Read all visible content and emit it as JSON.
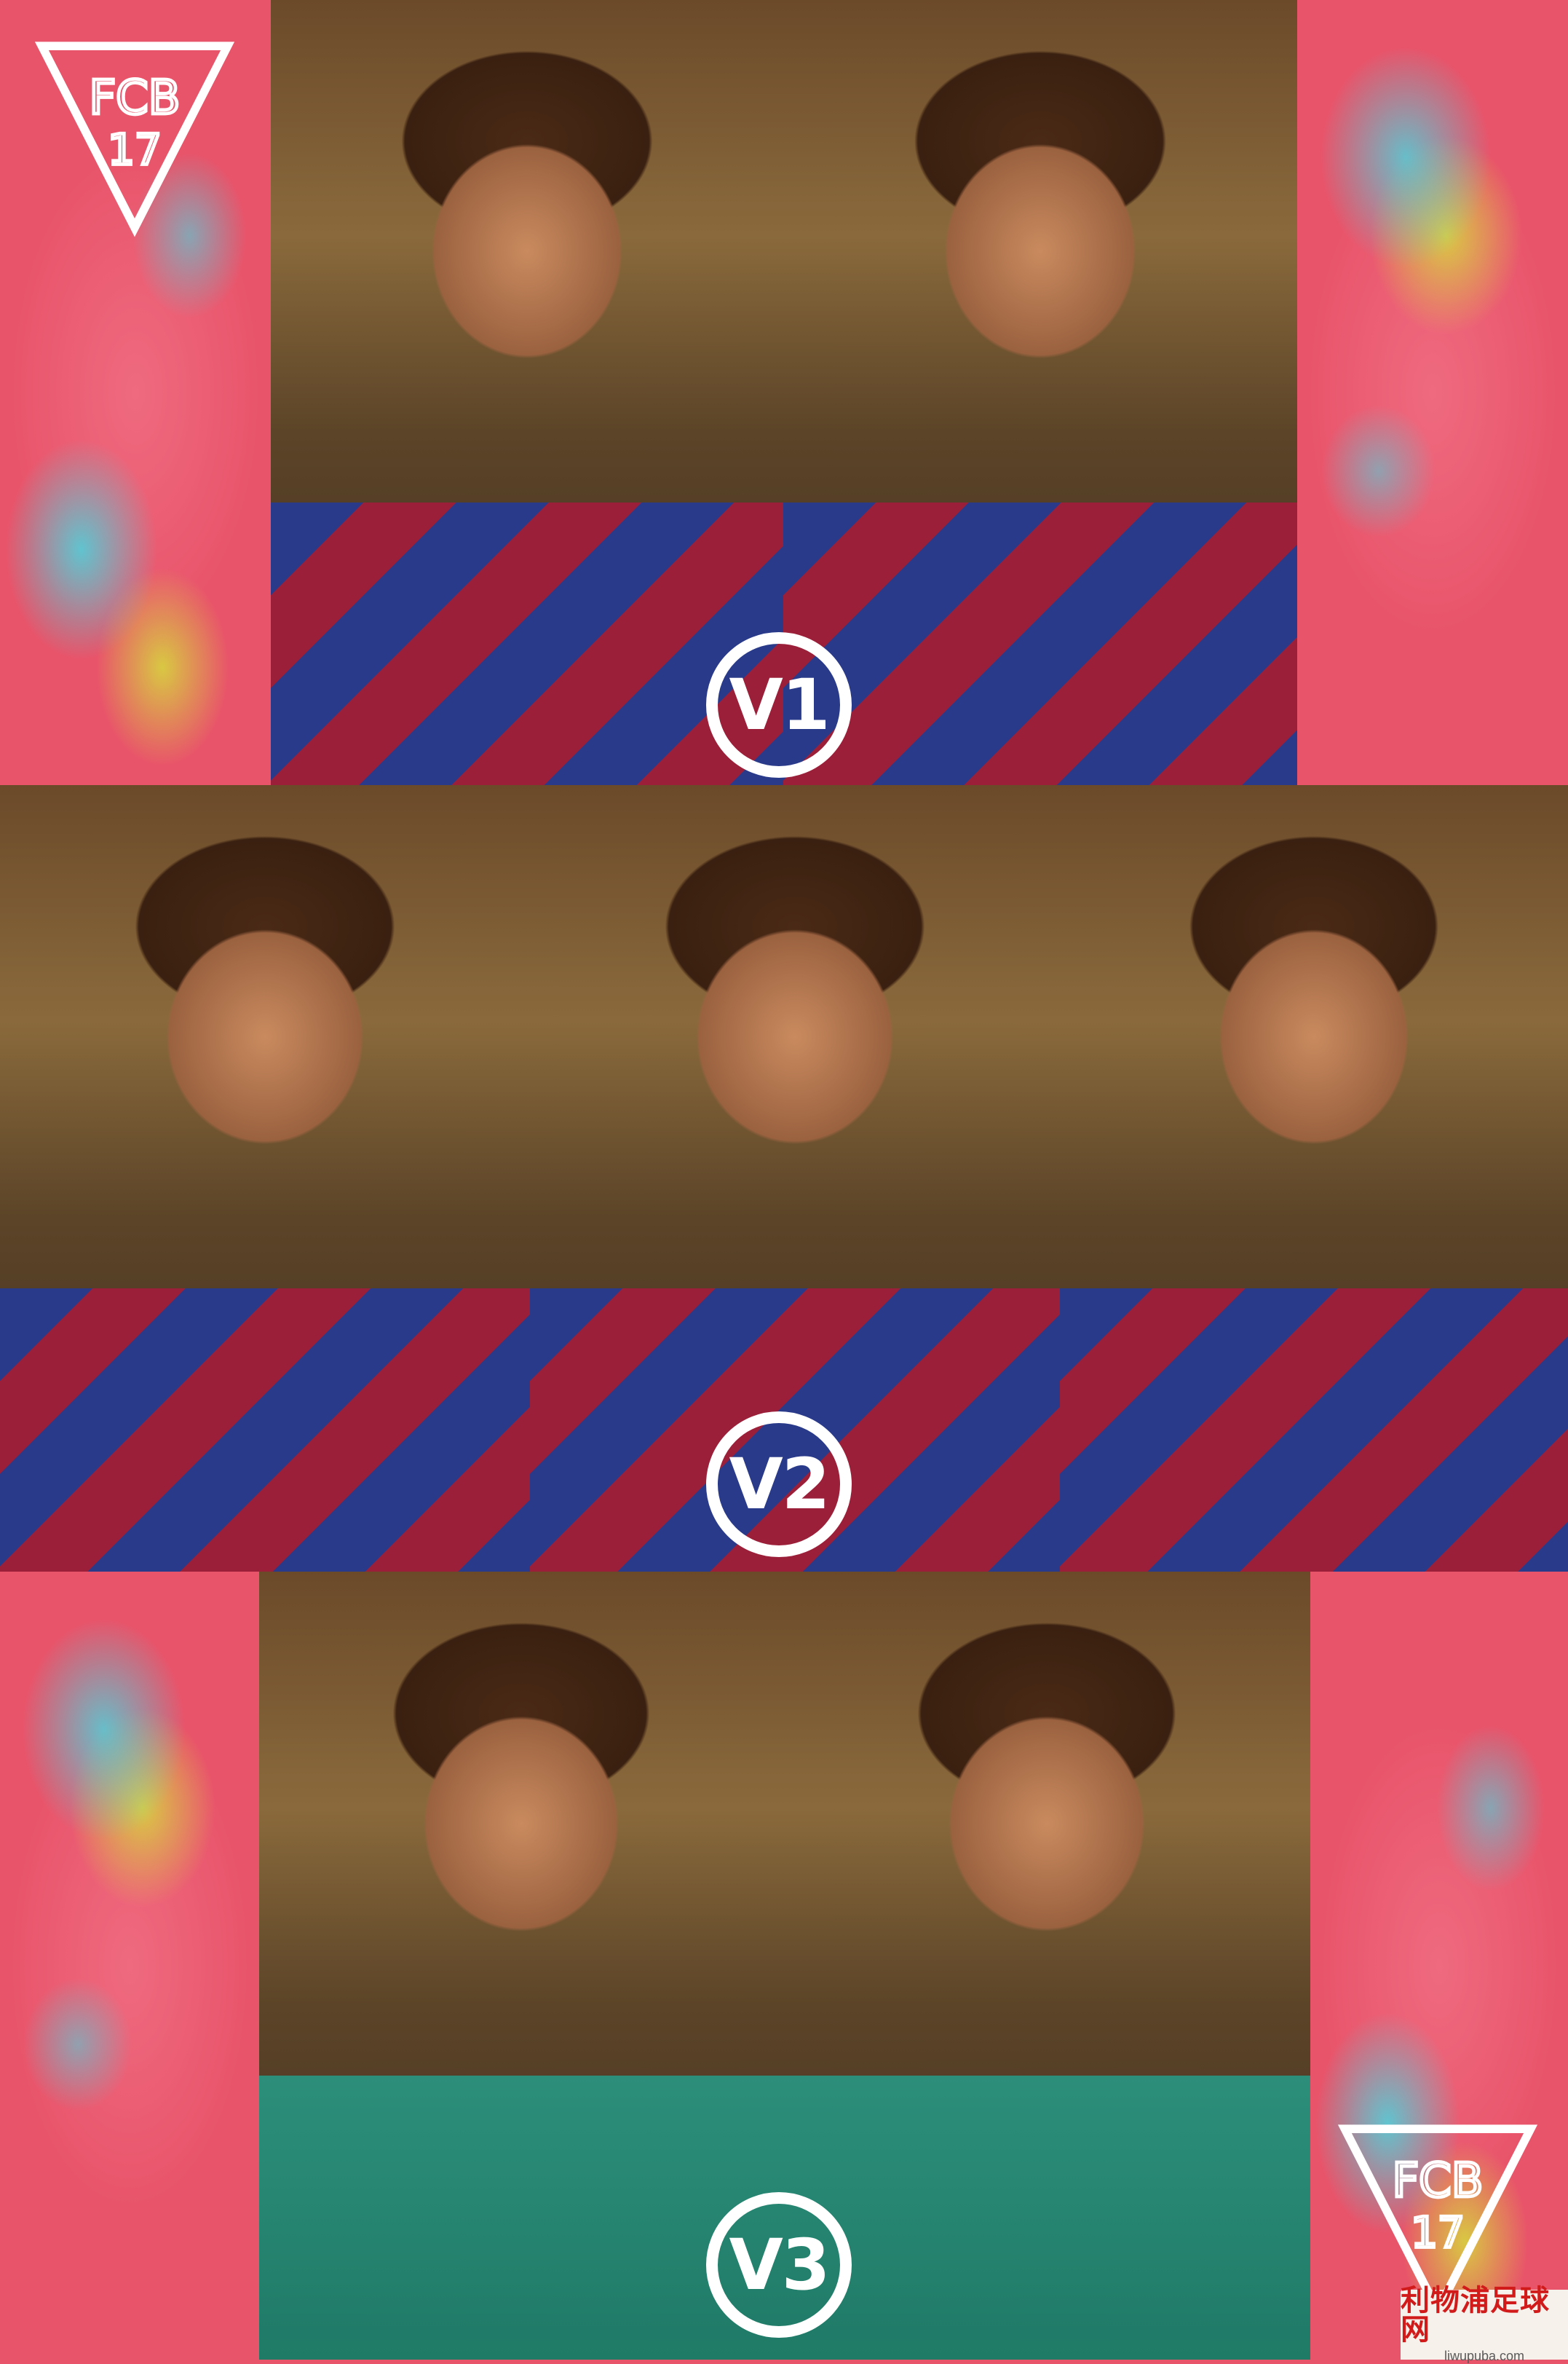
{
  "rows": {
    "v1": {
      "badge": "V1"
    },
    "v2": {
      "badge": "V2"
    },
    "v3": {
      "badge": "V3"
    }
  },
  "logo": {
    "letters": "FCB",
    "number": "17",
    "icon": "fcb17-triangle-logo"
  },
  "watermark": {
    "title": "利物浦足球网",
    "url": "liwupuba.com"
  },
  "colors": {
    "background_pink": "#e8556b",
    "splash_cyan": "#48d6e0",
    "splash_yellow": "#d6dc3c",
    "badge_white": "#ffffff",
    "watermark_red": "#d11b1b"
  }
}
